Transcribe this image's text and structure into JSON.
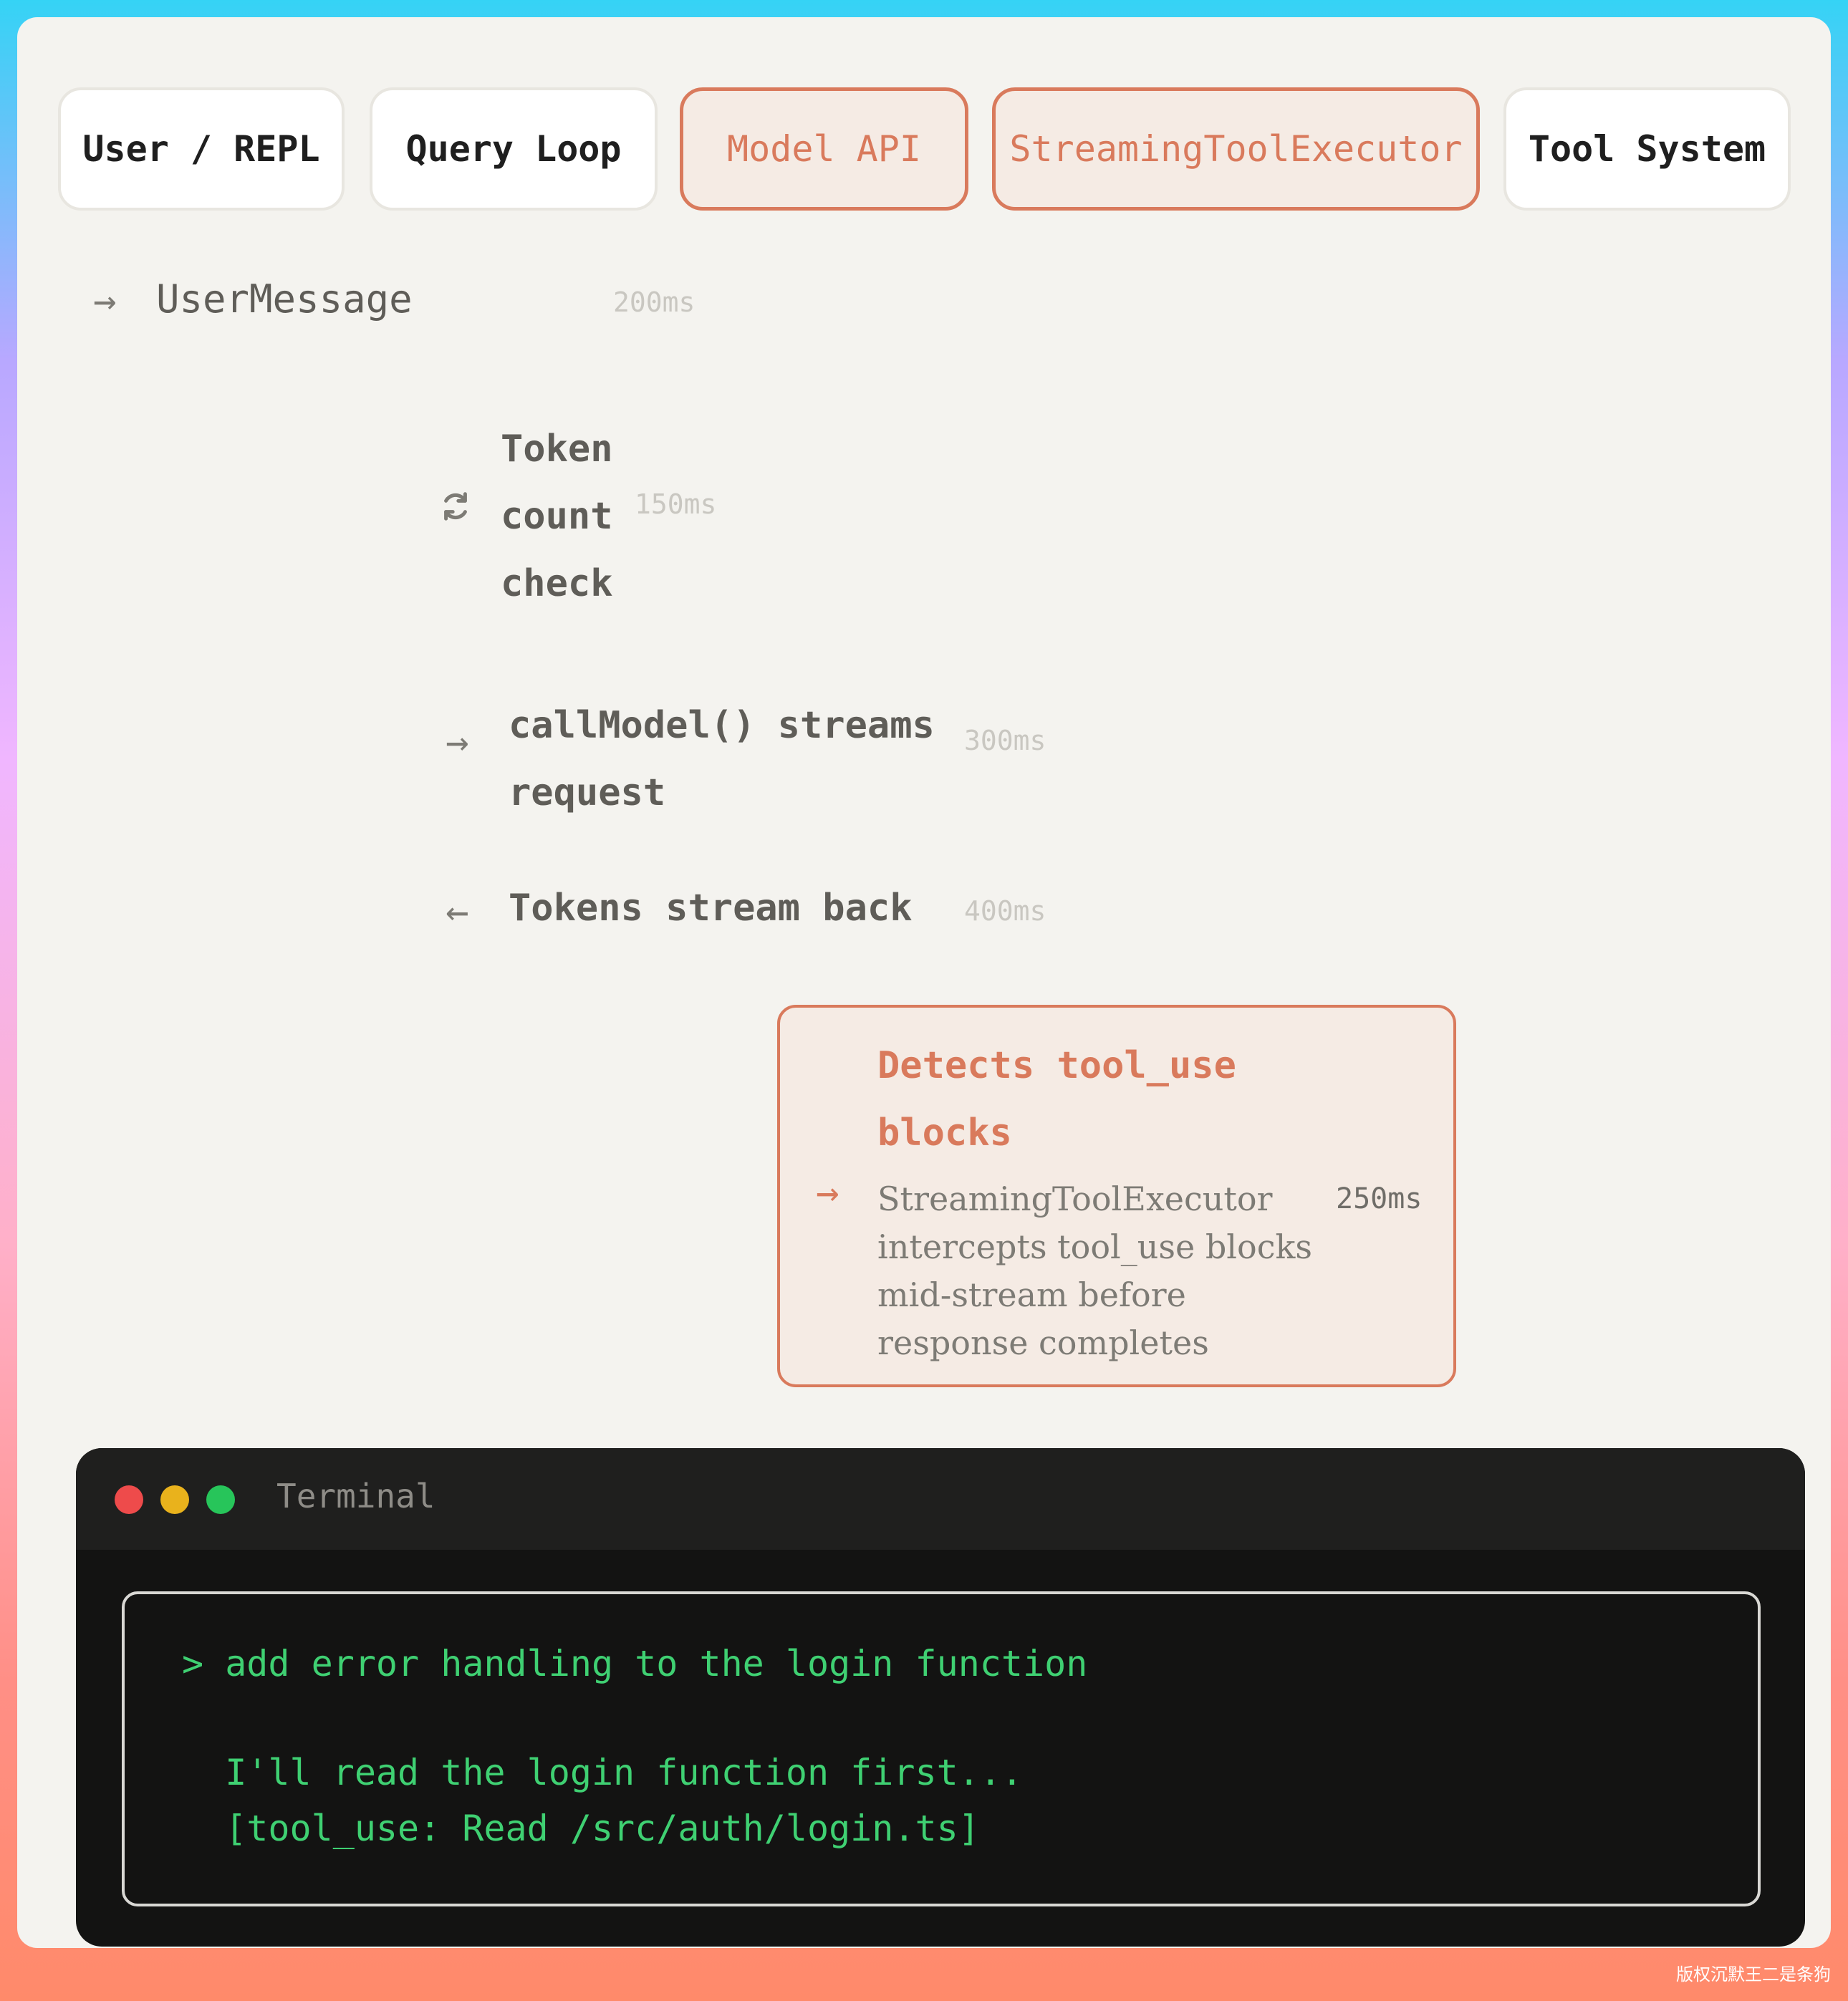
{
  "lanes": [
    {
      "label": "User / REPL",
      "active": false
    },
    {
      "label": "Query Loop",
      "active": false
    },
    {
      "label": "Model API",
      "active": true
    },
    {
      "label": "StreamingToolExecutor",
      "active": true
    },
    {
      "label": "Tool System",
      "active": false
    }
  ],
  "steps": {
    "user_message": {
      "arrow": "→",
      "label": "UserMessage",
      "time": "200ms"
    },
    "token_check": {
      "icon": "refresh-icon",
      "lines": [
        "Token",
        "count",
        "check"
      ],
      "time": "150ms"
    },
    "call_model": {
      "arrow": "→",
      "lines": [
        "callModel() streams",
        "request"
      ],
      "time": "300ms"
    },
    "tokens_back": {
      "arrow": "←",
      "label": "Tokens stream back",
      "time": "400ms"
    },
    "detect": {
      "title_lines": [
        "Detects tool_use",
        "blocks"
      ],
      "arrow": "→",
      "desc_lines": [
        "StreamingToolExecutor",
        "intercepts tool_use blocks",
        "mid-stream before",
        "response completes"
      ],
      "time": "250ms"
    }
  },
  "terminal": {
    "title": "Terminal",
    "lines": [
      "> add error handling to the login function",
      "  I'll read the login function first...",
      "  [tool_use: Read /src/auth/login.ts]"
    ]
  },
  "colors": {
    "accent": "#d97a5c",
    "terminal_green": "#3fd072",
    "card_bg": "#f4f3ef"
  },
  "credit": "版权沉默王二是条狗"
}
